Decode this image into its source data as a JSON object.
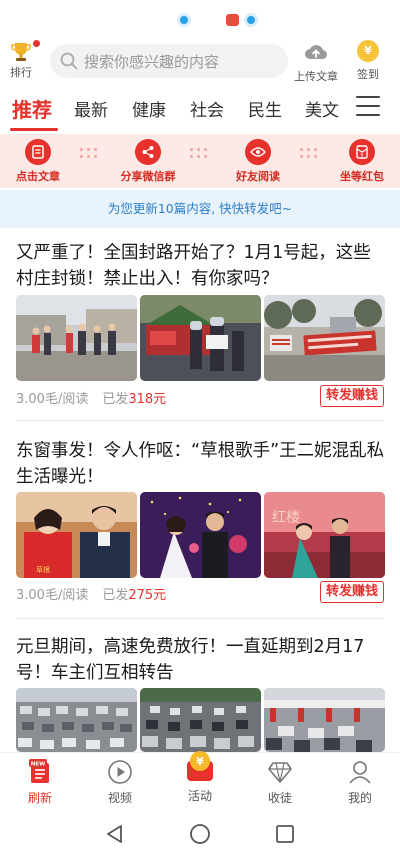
{
  "header": {
    "rank_label": "排行",
    "search_placeholder": "搜索你感兴趣的内容",
    "upload_label": "上传文章",
    "signin_label": "签到",
    "signin_coin": "¥"
  },
  "tabs": [
    {
      "label": "推荐"
    },
    {
      "label": "最新"
    },
    {
      "label": "健康"
    },
    {
      "label": "社会"
    },
    {
      "label": "民生"
    },
    {
      "label": "美文"
    }
  ],
  "quick_actions": [
    {
      "label": "点击文章",
      "icon": "document-icon"
    },
    {
      "label": "分享微信群",
      "icon": "share-icon"
    },
    {
      "label": "好友阅读",
      "icon": "eye-icon"
    },
    {
      "label": "坐等红包",
      "icon": "red-envelope-icon"
    }
  ],
  "notice": "为您更新10篇内容, 快快转发吧~",
  "articles": [
    {
      "title": "又严重了！全国封路开始了？1月1号起，这些村庄封锁！禁止出入！有你家吗？",
      "rate": "3.00毛/阅读",
      "sent_prefix": "已发",
      "sent_amount": "318元",
      "share_label": "转发赚钱"
    },
    {
      "title": "东窗事发！令人作呕：“草根歌手”王二妮混乱私生活曝光！",
      "rate": "3.00毛/阅读",
      "sent_prefix": "已发",
      "sent_amount": "275元",
      "share_label": "转发赚钱"
    },
    {
      "title": "元旦期间，高速免费放行！一直延期到2月17号！车主们互相转告"
    }
  ],
  "bottom_nav": [
    {
      "label": "刷新",
      "badge": "NEW"
    },
    {
      "label": "视频"
    },
    {
      "label": "活动",
      "coin": "¥"
    },
    {
      "label": "收徒"
    },
    {
      "label": "我的"
    }
  ],
  "colors": {
    "accent": "#e6312d",
    "notice_text": "#2f7fc8",
    "notice_bg": "#e8f3fc",
    "quick_bg": "#fde9e6"
  }
}
